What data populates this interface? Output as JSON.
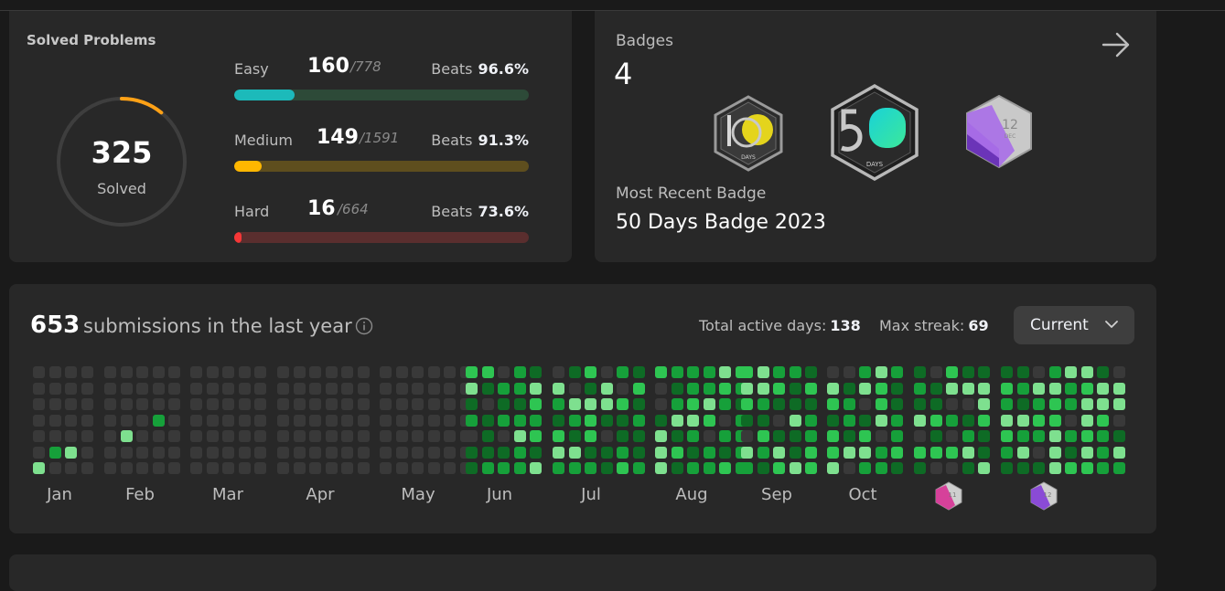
{
  "solved": {
    "title": "Solved Problems",
    "total": "325",
    "label": "Solved",
    "difficulties": [
      {
        "name": "Easy",
        "count": "160",
        "total": "/778",
        "beats_label": "Beats",
        "beats": "96.6%",
        "fraction": 0.206,
        "color": "#1cbaba",
        "track": "#2d4a38"
      },
      {
        "name": "Medium",
        "count": "149",
        "total": "/1591",
        "beats_label": "Beats",
        "beats": "91.3%",
        "fraction": 0.094,
        "color": "#ffb700",
        "track": "#5e4e1e"
      },
      {
        "name": "Hard",
        "count": "16",
        "total": "/664",
        "beats_label": "Beats",
        "beats": "73.6%",
        "fraction": 0.024,
        "color": "#f63737",
        "track": "#5a2e2e"
      }
    ],
    "ring_fraction": 0.108,
    "ring_color": "#ffa116"
  },
  "badges": {
    "title": "Badges",
    "count": "4",
    "icons": [
      "badge-100-days-icon",
      "badge-50-days-icon",
      "badge-12-dec-icon"
    ],
    "badge_100_caption": "DAYS",
    "badge_50_caption": "DAYS",
    "badge_12_day": "12",
    "badge_12_month": "DEC",
    "recent_title": "Most Recent Badge",
    "recent_name": "50 Days Badge 2023"
  },
  "submissions": {
    "count": "653",
    "text": "submissions in the last year",
    "active_label": "Total active days:",
    "active_value": "138",
    "streak_label": "Max streak:",
    "streak_value": "69",
    "dropdown": "Current",
    "months": [
      "Jan",
      "Feb",
      "Mar",
      "Apr",
      "May",
      "Jun",
      "Jul",
      "Aug",
      "Sep",
      "Oct"
    ],
    "mini_badges": [
      {
        "day": "11",
        "color": "#d6419a"
      },
      {
        "day": "12",
        "color": "#8a4bd6"
      }
    ],
    "colors": {
      "empty": "#393939",
      "l1": "#0e6b25",
      "l2": "#16a03a",
      "l3": "#2ec552",
      "l4": "#7ee08f"
    }
  }
}
